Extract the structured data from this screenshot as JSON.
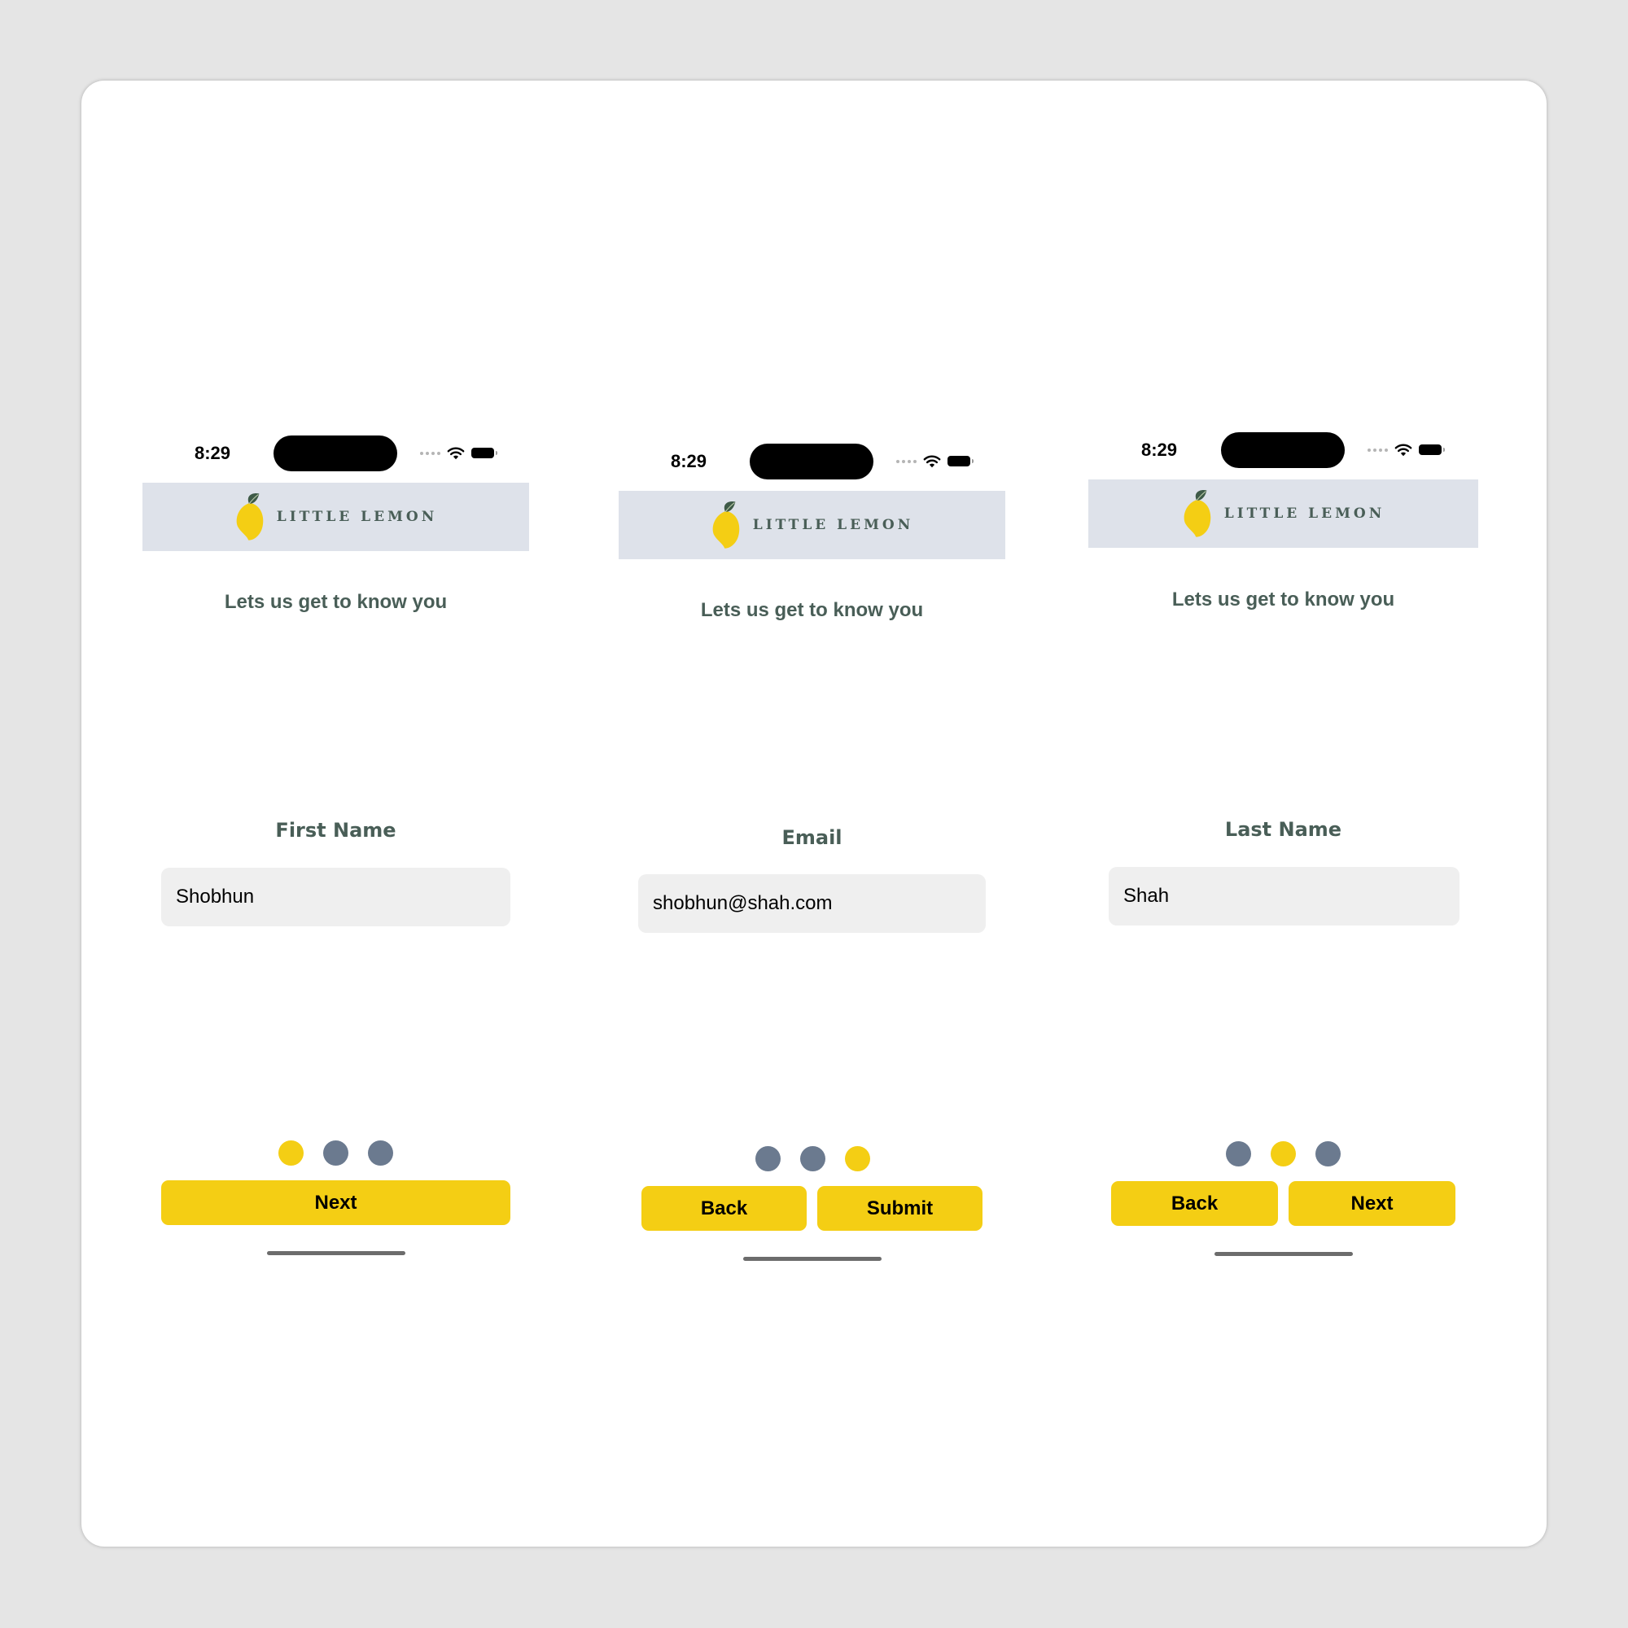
{
  "colors": {
    "page_background": "#e5e5e5",
    "card": "#ffffff",
    "header": "#dee2ea",
    "brand_text": "#495e57",
    "accent_yellow": "#f4ce14",
    "dot_inactive": "#6b7a8f",
    "input_background": "#efefef"
  },
  "brand": {
    "name": "LITTLE LEMON",
    "logo_icon": "lemon-icon"
  },
  "screens": [
    {
      "status": {
        "time": "8:29"
      },
      "tagline": "Lets us get to know you",
      "field": {
        "label": "First Name",
        "value": "Shobhun"
      },
      "pager": {
        "current_step": 1,
        "total_steps": 3
      },
      "buttons": {
        "next": "Next"
      }
    },
    {
      "status": {
        "time": "8:29"
      },
      "tagline": "Lets us get to know you",
      "field": {
        "label": "Email",
        "value": "shobhun@shah.com"
      },
      "pager": {
        "current_step": 3,
        "total_steps": 3
      },
      "buttons": {
        "back": "Back",
        "submit": "Submit"
      }
    },
    {
      "status": {
        "time": "8:29"
      },
      "tagline": "Lets us get to know you",
      "field": {
        "label": "Last Name",
        "value": "Shah"
      },
      "pager": {
        "current_step": 2,
        "total_steps": 3
      },
      "buttons": {
        "back": "Back",
        "next": "Next"
      }
    }
  ]
}
